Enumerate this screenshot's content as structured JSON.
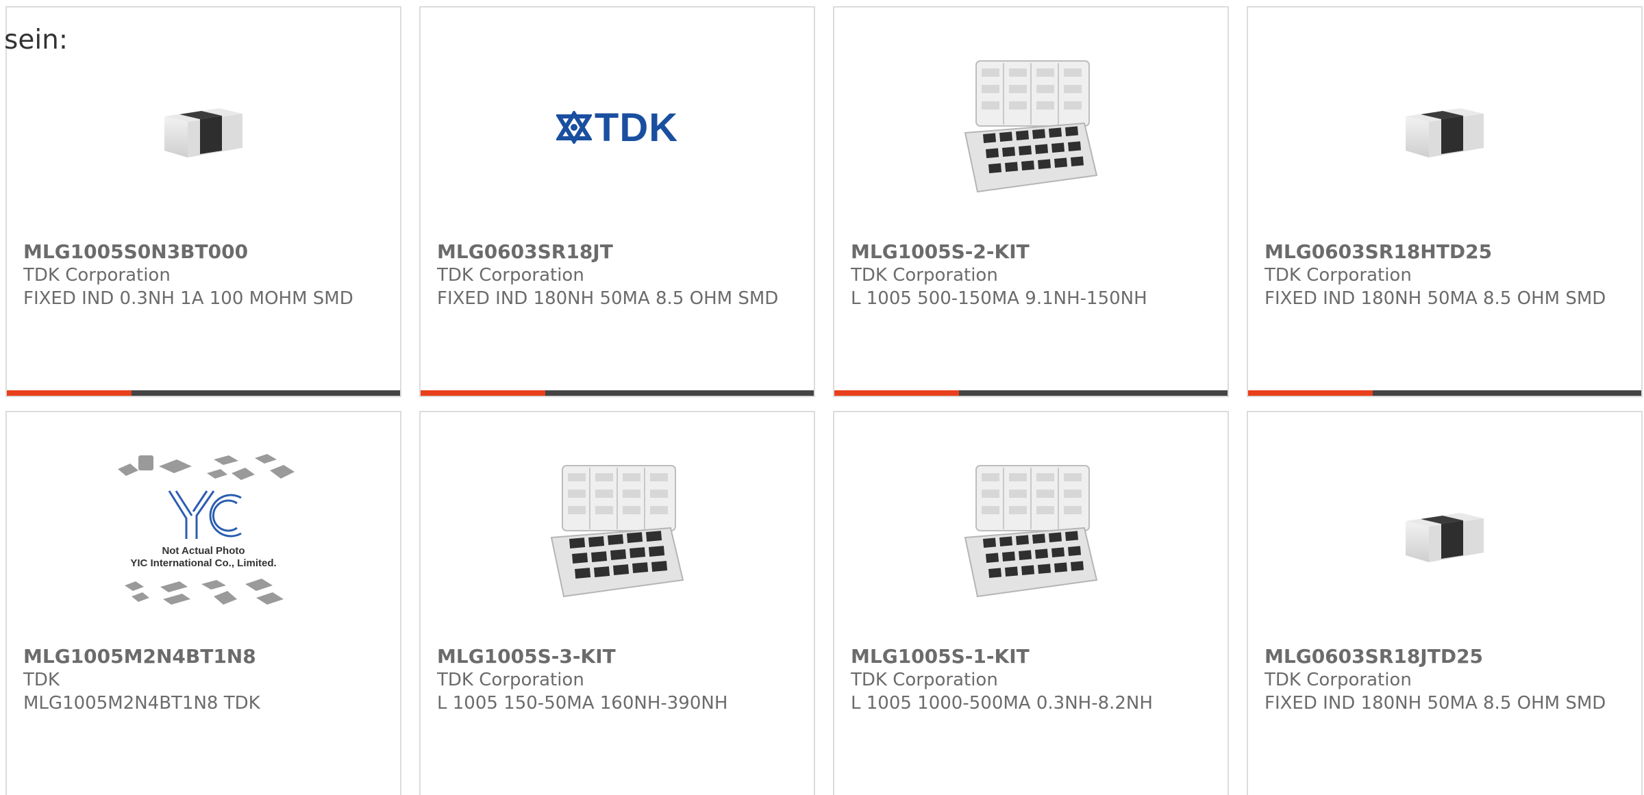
{
  "intro_text": "sein:",
  "colors": {
    "accent": "#e8401c",
    "bar_dark": "#444444",
    "text_gray": "#6b6b6b",
    "tdk_blue": "#1a4fa0"
  },
  "products": [
    {
      "part_number": "MLG1005S0N3BT000",
      "manufacturer": "TDK Corporation",
      "description": "FIXED IND 0.3NH 1A 100 MOHM SMD",
      "image": "chip-inductor-image"
    },
    {
      "part_number": "MLG0603SR18JT",
      "manufacturer": "TDK Corporation",
      "description": "FIXED IND 180NH 50MA 8.5 OHM SMD",
      "image": "tdk-logo-image",
      "logo_text": "TDK"
    },
    {
      "part_number": "MLG1005S-2-KIT",
      "manufacturer": "TDK Corporation",
      "description": "L 1005 500-150MA 9.1NH-150NH",
      "image": "kit-box-image"
    },
    {
      "part_number": "MLG0603SR18HTD25",
      "manufacturer": "TDK Corporation",
      "description": "FIXED IND 180NH 50MA 8.5 OHM SMD",
      "image": "chip-inductor-image"
    },
    {
      "part_number": "MLG1005M2N4BT1N8",
      "manufacturer": "TDK",
      "description": "MLG1005M2N4BT1N8 TDK",
      "image": "yic-placeholder-image",
      "placeholder_caption_1": "Not Actual Photo",
      "placeholder_caption_2": "YIC International Co., Limited."
    },
    {
      "part_number": "MLG1005S-3-KIT",
      "manufacturer": "TDK Corporation",
      "description": "L 1005 150-50MA 160NH-390NH",
      "image": "kit-box-image"
    },
    {
      "part_number": "MLG1005S-1-KIT",
      "manufacturer": "TDK Corporation",
      "description": "L 1005 1000-500MA 0.3NH-8.2NH",
      "image": "kit-box-image"
    },
    {
      "part_number": "MLG0603SR18JTD25",
      "manufacturer": "TDK Corporation",
      "description": "FIXED IND 180NH 50MA 8.5 OHM SMD",
      "image": "chip-inductor-image"
    }
  ]
}
